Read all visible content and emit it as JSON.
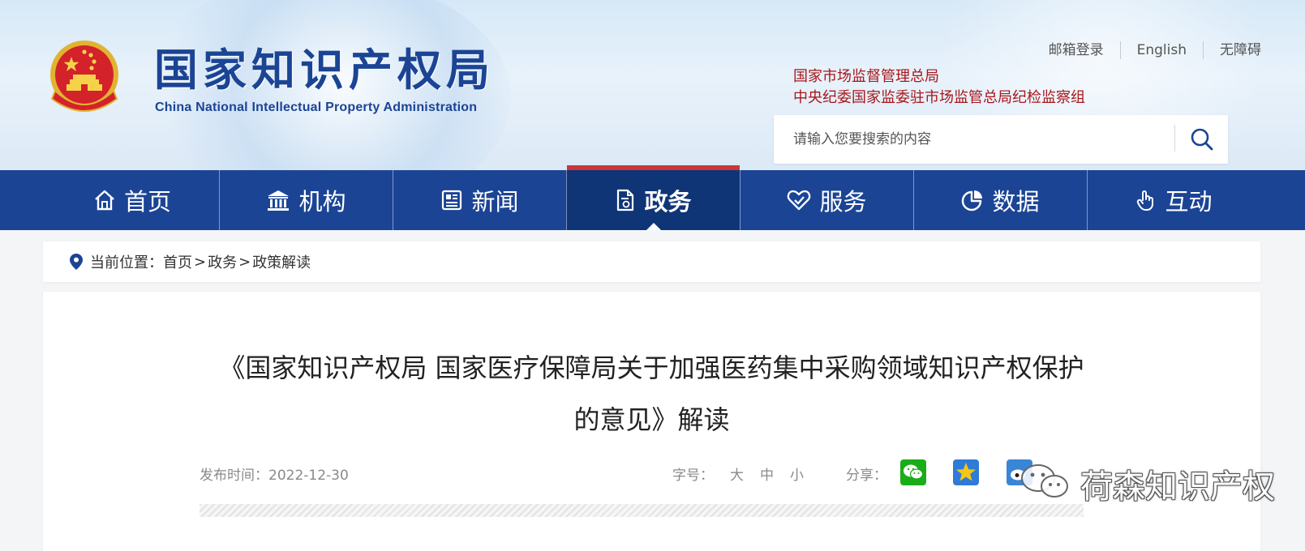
{
  "header": {
    "site_title": "国家知识产权局",
    "site_subtitle": "China National Intellectual Property Administration",
    "top_links": [
      "邮箱登录",
      "English",
      "无障碍"
    ],
    "org_links": [
      "国家市场监督管理总局",
      "中央纪委国家监委驻市场监管总局纪检监察组"
    ],
    "search_placeholder": "请输入您要搜索的内容"
  },
  "nav": {
    "items": [
      {
        "label": "首页",
        "icon": "home-icon"
      },
      {
        "label": "机构",
        "icon": "institution-icon"
      },
      {
        "label": "新闻",
        "icon": "news-icon"
      },
      {
        "label": "政务",
        "icon": "document-icon"
      },
      {
        "label": "服务",
        "icon": "service-heart-icon"
      },
      {
        "label": "数据",
        "icon": "pie-chart-icon"
      },
      {
        "label": "互动",
        "icon": "hand-pointer-icon"
      }
    ],
    "active_index": 3
  },
  "breadcrumb": {
    "prefix": "当前位置：",
    "items": [
      "首页",
      "政务",
      "政策解读"
    ],
    "separator": ">"
  },
  "article": {
    "title_line1": "《国家知识产权局 国家医疗保障局关于加强医药集中采购领域知识产权保护",
    "title_line2": "的意见》解读",
    "date_label": "发布时间：2022-12-30",
    "font_size_label": "字号：",
    "font_sizes": [
      "大",
      "中",
      "小"
    ],
    "share_label": "分享："
  },
  "watermark": {
    "text": "荷森知识产权"
  },
  "colors": {
    "nav_bg": "#1b4495",
    "nav_active": "#0f3577",
    "active_bar": "#c9373b",
    "org_link": "#a8161b",
    "title_blue": "#1b4495"
  }
}
